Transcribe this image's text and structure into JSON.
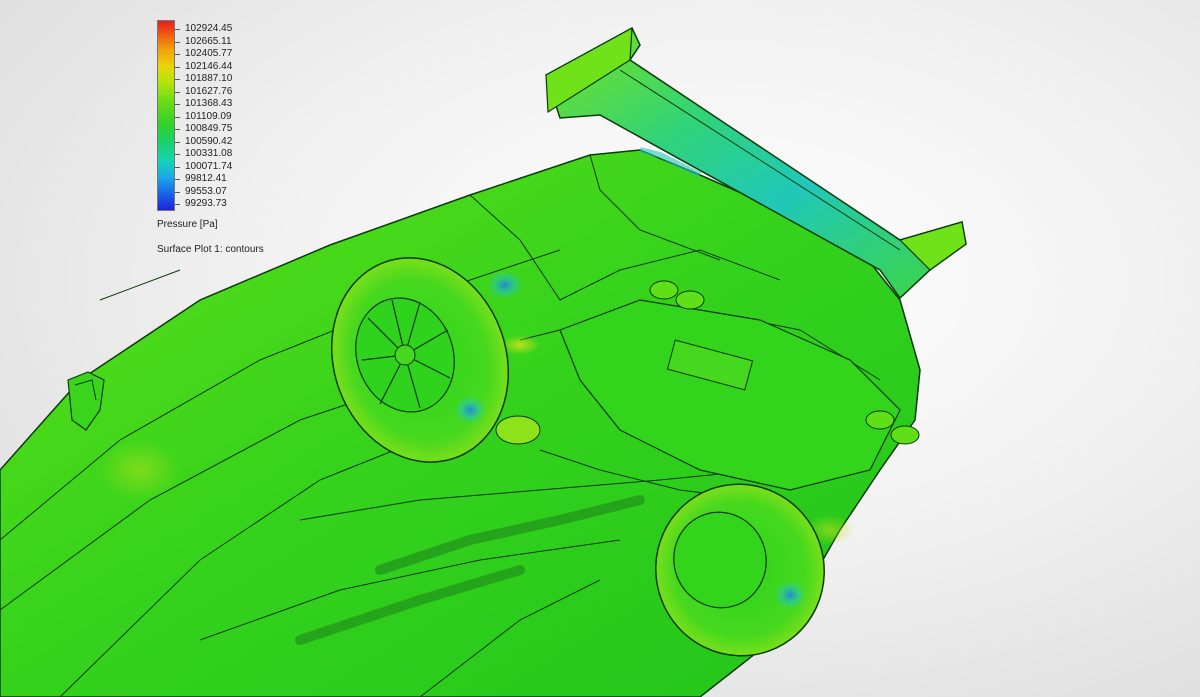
{
  "legend": {
    "values": [
      "102924.45",
      "102665.11",
      "102405.77",
      "102146.44",
      "101887.10",
      "101627.76",
      "101368.43",
      "101109.09",
      "100849.75",
      "100590.42",
      "100331.08",
      "100071.74",
      "99812.41",
      "99553.07",
      "99293.73"
    ],
    "quantity": "Pressure [Pa]",
    "plot_name": "Surface Plot 1: contours"
  },
  "colors": {
    "background": "#ececec",
    "surface_green": "#33d61c",
    "surface_bright": "#6fe21a",
    "surface_cyan": "#22c8b0",
    "surface_blue": "#1e8de6",
    "surface_yellow": "#c8e41a",
    "edge_lines": "#0b3a0b"
  }
}
